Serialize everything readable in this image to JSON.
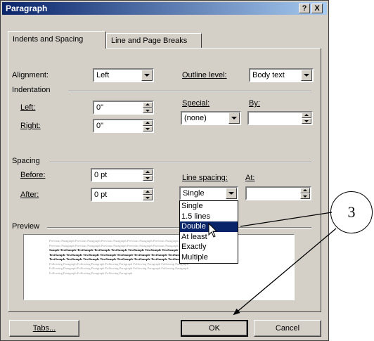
{
  "window": {
    "title": "Paragraph",
    "help_button": "?",
    "close_button": "X"
  },
  "tabs": [
    {
      "label": "Indents and Spacing",
      "active": true
    },
    {
      "label": "Line and Page Breaks",
      "active": false
    }
  ],
  "general": {
    "alignment_label": "Alignment:",
    "alignment_value": "Left",
    "outline_level_label": "Outline level:",
    "outline_level_value": "Body text"
  },
  "indentation": {
    "group_label": "Indentation",
    "left_label": "Left:",
    "left_value": "0\"",
    "right_label": "Right:",
    "right_value": "0\"",
    "special_label": "Special:",
    "special_value": "(none)",
    "by_label": "By:",
    "by_value": ""
  },
  "spacing": {
    "group_label": "Spacing",
    "before_label": "Before:",
    "before_value": "0 pt",
    "after_label": "After:",
    "after_value": "0 pt",
    "line_spacing_label": "Line spacing:",
    "line_spacing_value": "Single",
    "at_label": "At:",
    "at_value": "",
    "line_spacing_options": [
      "Single",
      "1.5 lines",
      "Double",
      "At least",
      "Exactly",
      "Multiple"
    ],
    "highlighted_option": "Double"
  },
  "preview": {
    "group_label": "Preview",
    "lines": [
      "Previous Paragraph Previous Paragraph Previous Paragraph Previous Paragraph Previous Paragraph Previous",
      "Previous Paragraph Previous Paragraph Previous Paragraph Previous Paragraph Previous Paragraph",
      "Sample TextSample TextSample TextSample TextSample TextSample TextSample TextSample TextSample",
      "TextSample TextSample TextSample TextSample TextSample TextSample TextSample TextSample Text",
      "TextSample TextSample TextSample TextSample TextSample TextSample TextSample TextSample Text",
      "Following Paragraph Following Paragraph Following Paragraph Following Paragraph Following Paragraph",
      "Following Paragraph Following Paragraph Following Paragraph Following Paragraph Following Paragraph",
      "Following Paragraph Following Paragraph Following Paragraph"
    ]
  },
  "buttons": {
    "tabs": "Tabs...",
    "ok": "OK",
    "cancel": "Cancel"
  },
  "annotation": {
    "callout_number": "3"
  }
}
